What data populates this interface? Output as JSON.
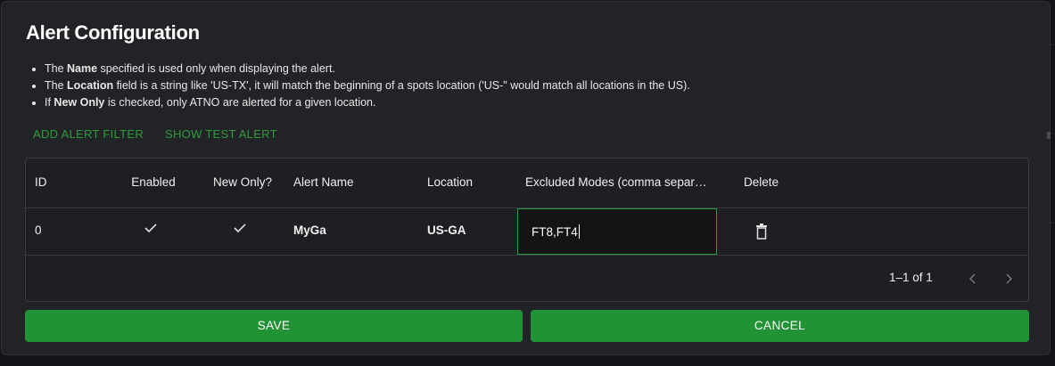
{
  "dialog": {
    "title": "Alert Configuration",
    "bullets": [
      {
        "pre": "The ",
        "bold": "Name",
        "post": " specified is used only when displaying the alert."
      },
      {
        "pre": "The ",
        "bold": "Location",
        "post": " field is a string like 'US-TX', it will match the beginning of a spots location ('US-\" would match all locations in the US)."
      },
      {
        "pre": "If ",
        "bold": "New Only",
        "post": " is checked, only ATNO are alerted for a given location."
      }
    ],
    "actions": {
      "add_filter": "ADD ALERT FILTER",
      "show_test": "SHOW TEST ALERT"
    }
  },
  "grid": {
    "columns": [
      "ID",
      "Enabled",
      "New Only?",
      "Alert Name",
      "Location",
      "Excluded Modes (comma separ…",
      "Delete"
    ],
    "rows": [
      {
        "id": "0",
        "enabled": true,
        "new_only": true,
        "alert_name": "MyGa",
        "location": "US-GA",
        "excluded_modes": "FT8,FT4"
      }
    ],
    "pagination": "1–1 of 1"
  },
  "buttons": {
    "save": "SAVE",
    "cancel": "CANCEL"
  },
  "colors": {
    "accent": "#229335",
    "link": "#2e9b3a",
    "background": "#222327"
  },
  "icons": {
    "check": "check-icon",
    "delete": "trash-icon",
    "prev": "chevron-left-icon",
    "next": "chevron-right-icon"
  }
}
